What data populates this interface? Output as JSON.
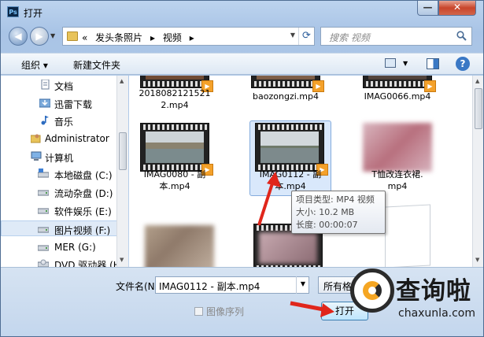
{
  "window": {
    "title": "打开",
    "app_icon": "Ps",
    "minimize_label": "—",
    "close_label": "✕"
  },
  "address": {
    "crumb_prefix": "«",
    "crumbs": [
      "发头条照片",
      "视频"
    ],
    "chevron": "▸",
    "search_placeholder": "搜索 视频"
  },
  "toolbar": {
    "organize": "组织 ▾",
    "new_folder": "新建文件夹",
    "help": "?"
  },
  "nav": {
    "items": [
      {
        "label": "文档",
        "icon": "document-icon"
      },
      {
        "label": "迅雷下载",
        "icon": "download-icon"
      },
      {
        "label": "音乐",
        "icon": "music-icon"
      },
      {
        "label": "Administrator",
        "icon": "user-folder-icon"
      },
      {
        "label": "计算机",
        "icon": "computer-icon"
      },
      {
        "label": "本地磁盘 (C:)",
        "icon": "system-drive-icon"
      },
      {
        "label": "流动杂盘 (D:)",
        "icon": "drive-icon"
      },
      {
        "label": "软件娱乐 (E:)",
        "icon": "drive-icon"
      },
      {
        "label": "图片视频 (F:)",
        "icon": "drive-icon"
      },
      {
        "label": "MER (G:)",
        "icon": "drive-icon"
      },
      {
        "label": "DVD 驱动器 (H",
        "icon": "dvd-drive-icon"
      }
    ]
  },
  "files": [
    {
      "name_line1": "2018082121521",
      "name_line2": "2.mp4"
    },
    {
      "name_line1": "baozongzi.mp4",
      "name_line2": ""
    },
    {
      "name_line1": "IMAG0066.mp4",
      "name_line2": ""
    },
    {
      "name_line1": "IMAG0080 - 副",
      "name_line2": "本.mp4"
    },
    {
      "name_line1": "IMAG0112 - 副",
      "name_line2": "本.mp4"
    },
    {
      "name_line1": "T恤改连衣裙.",
      "name_line2": "mp4"
    }
  ],
  "tooltip": {
    "type": "项目类型: MP4 视频",
    "size": "大小: 10.2 MB",
    "duration": "长度: 00:00:07"
  },
  "bottom": {
    "filename_label": "文件名(N):",
    "filename_value": "IMAG0112 - 副本.mp4",
    "filetype_value": "所有格式",
    "image_sequence_label": "图像序列",
    "open_button": "打开"
  },
  "watermark": {
    "chinese": "查询啦",
    "domain": "chaxunla.com"
  },
  "colors": {
    "accent": "#3a78c5",
    "annotation_red": "#e0261b",
    "watermark_orange": "#f5a623"
  }
}
